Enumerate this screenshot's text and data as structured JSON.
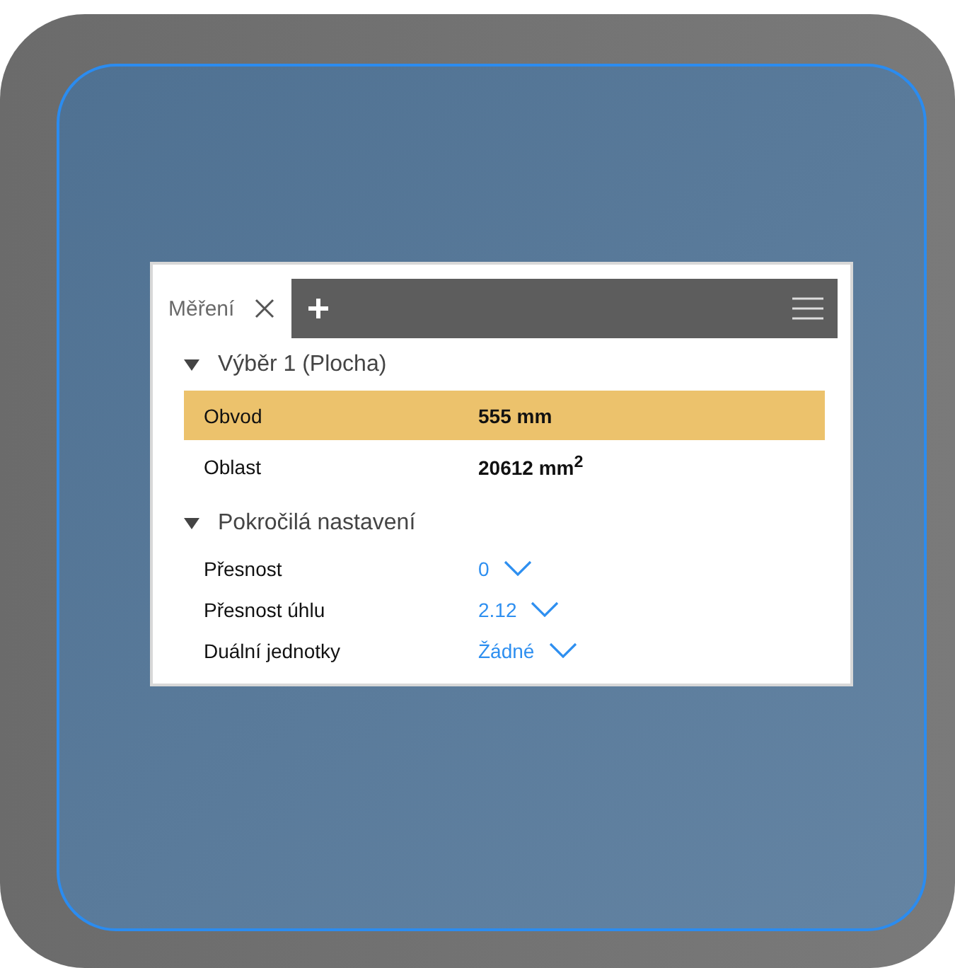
{
  "panel": {
    "tabs": [
      {
        "label": "Měření",
        "selected": true
      }
    ],
    "sections": [
      {
        "title": "Výběr 1 (Plocha)",
        "expanded": true,
        "kind": "results",
        "rows": [
          {
            "label": "Obvod",
            "value": "555 mm",
            "selected": true
          },
          {
            "label": "Oblast",
            "value": "20612 mm$^{2}$",
            "selected": false
          }
        ]
      },
      {
        "title": "Pokročilá nastavení",
        "expanded": true,
        "kind": "settings",
        "rows": [
          {
            "label": "Přesnost",
            "value": "0"
          },
          {
            "label": "Přesnost úhlu",
            "value": "2.12"
          },
          {
            "label": "Duální jednotky",
            "value": "Žádné"
          }
        ]
      }
    ]
  }
}
